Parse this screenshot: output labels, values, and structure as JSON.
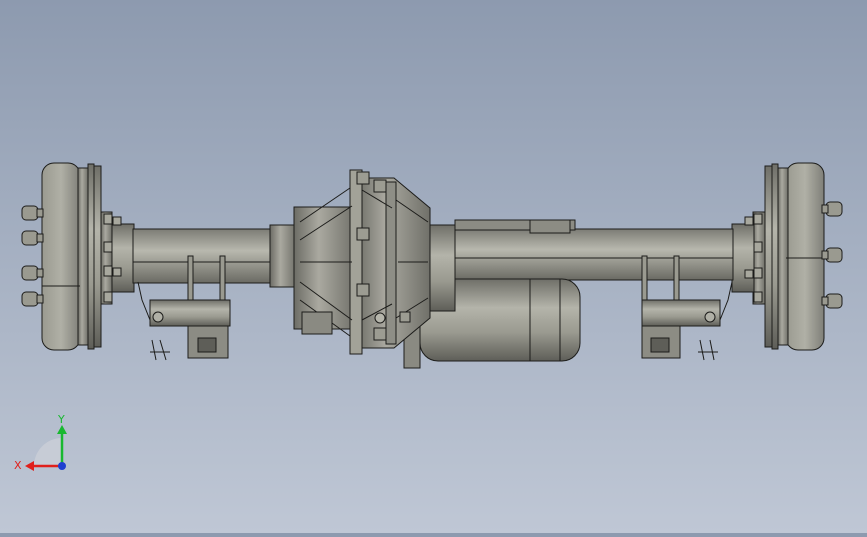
{
  "viewport": {
    "background_top": "#8d9aaf",
    "background_bottom": "#bfc7d5",
    "model_color": "#8f8f86",
    "model_edge_color": "#1c1c1a"
  },
  "triad": {
    "x_label": "X",
    "y_label": "Y",
    "x_color": "#e0201c",
    "y_color": "#18b830",
    "z_color": "#2040d0"
  }
}
